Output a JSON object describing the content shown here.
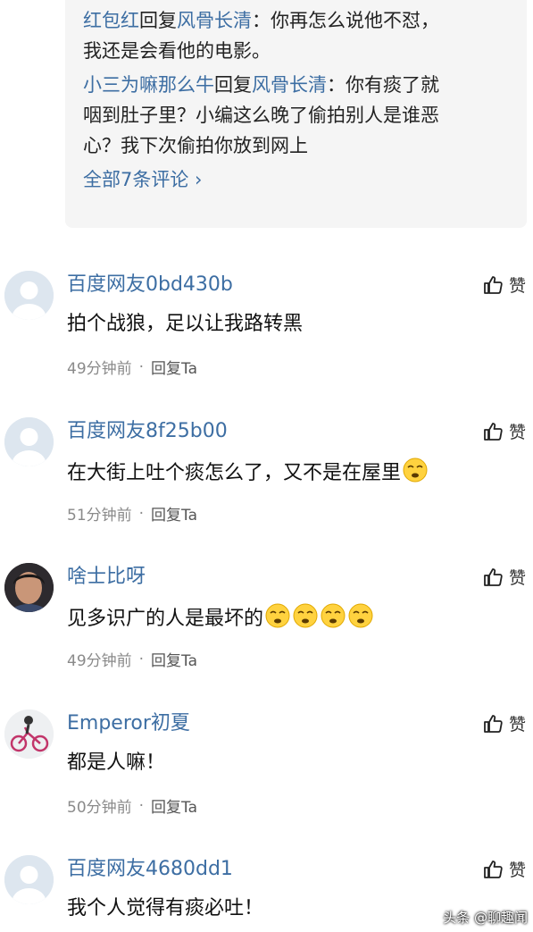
{
  "reply_thread": {
    "replies": [
      {
        "user": "红包红",
        "verb": "回复",
        "target": "风骨长清",
        "text": "：你再怎么说他不怼，",
        "text2": "我还是会看他的电影。"
      },
      {
        "user": "小三为嘛那么牛",
        "verb": "回复",
        "target": "风骨长清",
        "text": "：你有痰了就",
        "text2": "咽到肚子里？小编这么晚了偷拍别人是谁恶",
        "text3": "心？我下次偷拍你放到网上"
      }
    ],
    "more_label": "全部7条评论 ›"
  },
  "comments": [
    {
      "user": "百度网友0bd430b",
      "text": "拍个战狼，足以让我路转黑",
      "time": "49分钟前",
      "reply": "回复Ta",
      "like": "赞",
      "emoji_count": 0
    },
    {
      "user": "百度网友8f25b00",
      "text": "在大街上吐个痰怎么了，又不是在屋里",
      "time": "51分钟前",
      "reply": "回复Ta",
      "like": "赞",
      "emoji_count": 1
    },
    {
      "user": "啥士比呀",
      "text": "见多识广的人是最坏的",
      "time": "49分钟前",
      "reply": "回复Ta",
      "like": "赞",
      "emoji_count": 4
    },
    {
      "user": "Emperor初夏",
      "text": "都是人嘛！",
      "time": "50分钟前",
      "reply": "回复Ta",
      "like": "赞",
      "emoji_count": 0
    },
    {
      "user": "百度网友4680dd1",
      "text": "我个人觉得有痰必吐！",
      "like": "赞",
      "emoji_count": 0
    }
  ],
  "watermark": "头条 @聊趣闻",
  "colors": {
    "link": "#3d6ea3",
    "reply_bg": "#f5f5f5",
    "meta": "#8a8a8a"
  }
}
